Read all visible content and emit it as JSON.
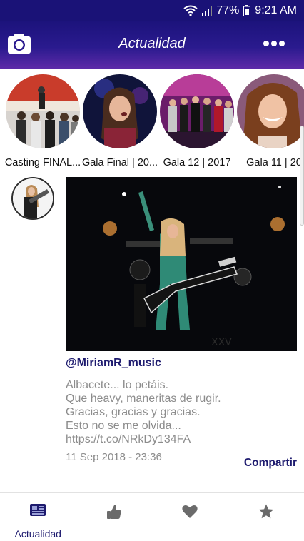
{
  "status": {
    "battery": "77%",
    "time": "9:21 AM"
  },
  "header": {
    "title": "Actualidad",
    "left_icon": "camera-icon",
    "right_icon": "more-dots-icon"
  },
  "stories": [
    {
      "label": "Casting FINAL..."
    },
    {
      "label": "Gala Final | 20..."
    },
    {
      "label": "Gala 12 | 2017"
    },
    {
      "label": "Gala 11 | 20"
    }
  ],
  "post": {
    "handle": "@MiriamR_music",
    "text": "Albacete... lo petáis.\nQue heavy, maneritas de rugir.\nGracias, gracias y gracias.\nEsto no se me olvida...\nhttps://t.co/NRkDy134FA",
    "date": "11 Sep 2018 - 23:36",
    "share_label": "Compartir"
  },
  "nav": [
    {
      "label": "Actualidad",
      "icon": "newspaper-icon",
      "active": true
    },
    {
      "label": "",
      "icon": "thumbs-up-icon"
    },
    {
      "label": "",
      "icon": "heart-icon"
    },
    {
      "label": "",
      "icon": "star-icon"
    }
  ],
  "colors": {
    "primary": "#1a1277",
    "accent": "#1d1a6e",
    "muted": "#8c8c8c",
    "nav_icon": "#6b6b6b"
  }
}
